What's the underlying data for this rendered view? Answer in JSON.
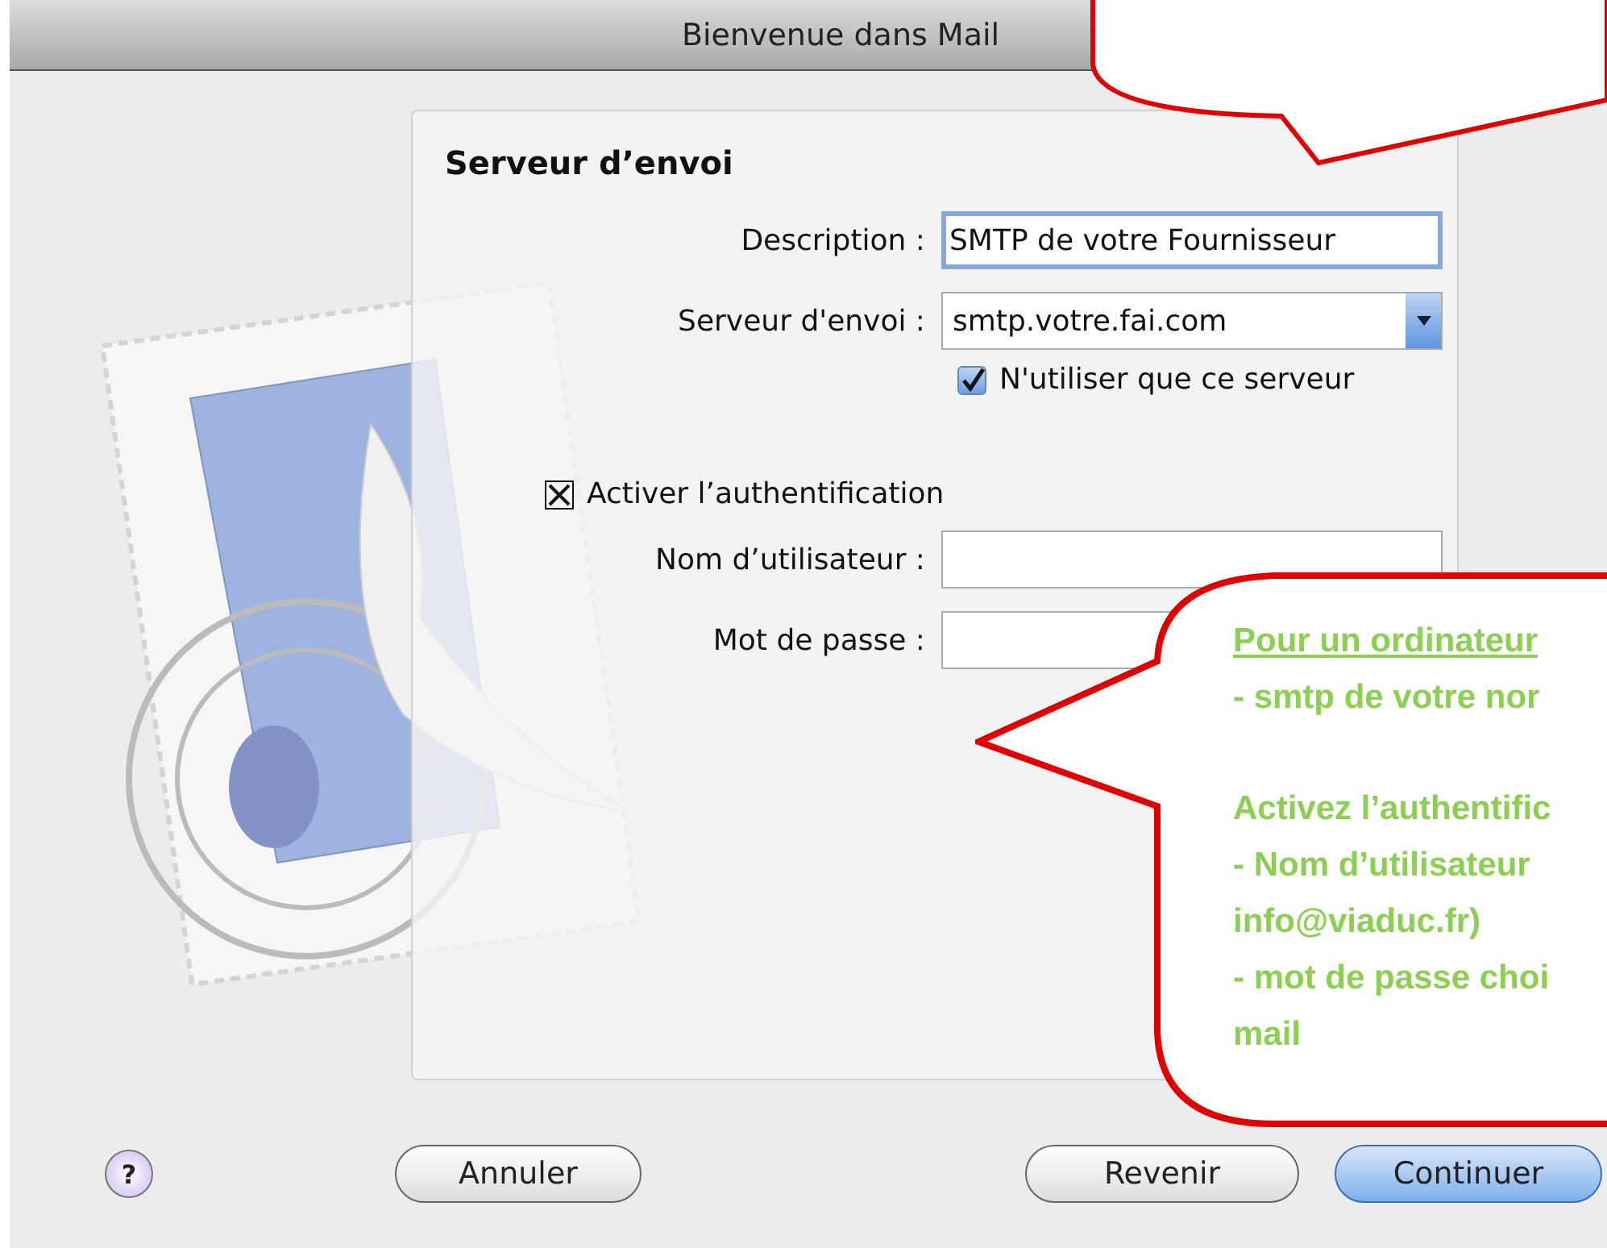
{
  "window": {
    "title": "Bienvenue dans Mail"
  },
  "panel": {
    "heading": "Serveur d’envoi",
    "rows": [
      {
        "kind": "text",
        "label": "Description :",
        "value": "SMTP de votre Fournisseur",
        "focused": true
      },
      {
        "kind": "popup",
        "label": "Serveur d'envoi :",
        "value": "smtp.votre.fai.com"
      },
      {
        "kind": "checkbox",
        "label": "N'utiliser que ce serveur",
        "checked": true
      },
      {
        "kind": "x-checkbox",
        "label": "Activer l’authentification",
        "checked": true
      },
      {
        "kind": "text",
        "label": "Nom d’utilisateur :",
        "focused": false
      },
      {
        "kind": "text",
        "label": "Mot de passe :",
        "focused": false
      }
    ]
  },
  "footer": {
    "help": "?",
    "buttons": [
      {
        "label": "Annuler",
        "default": false
      },
      {
        "label": "Revenir",
        "default": false
      },
      {
        "label": "Continuer",
        "default": true
      }
    ]
  },
  "annotation": {
    "paragraphs": [
      {
        "lines": [
          {
            "text": "Pour un ordinateur",
            "underlined": true
          },
          {
            "text": "- smtp de votre nor",
            "underlined": false
          }
        ]
      },
      {
        "lines": [
          {
            "text": "Activez l’authentific",
            "underlined": false
          },
          {
            "text": "- Nom d’utilisateur",
            "underlined": false
          },
          {
            "text": "info@viaduc.fr)",
            "underlined": false
          },
          {
            "text": "- mot de passe choi",
            "underlined": false
          },
          {
            "text": "mail",
            "underlined": false
          }
        ]
      }
    ]
  }
}
